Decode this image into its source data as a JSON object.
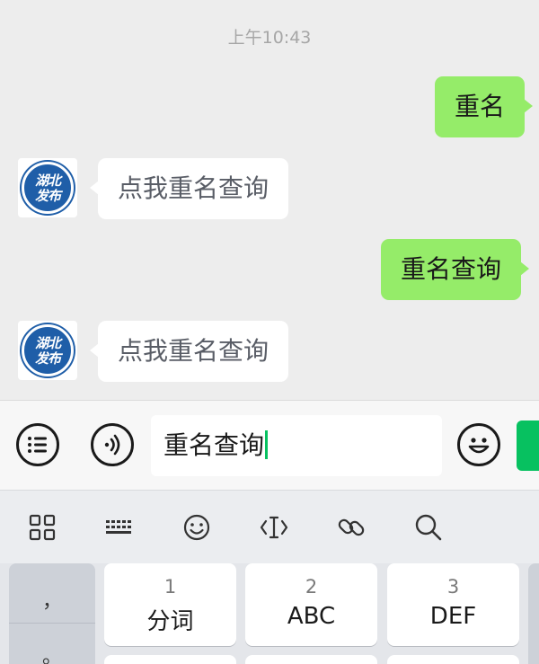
{
  "chat": {
    "timestamp": "上午10:43",
    "messages": [
      {
        "side": "out",
        "text": "重名"
      },
      {
        "side": "in",
        "text": "点我重名查询"
      },
      {
        "side": "out",
        "text": "重名查询"
      },
      {
        "side": "in",
        "text": "点我重名查询"
      }
    ]
  },
  "bot": {
    "avatar_text_line1": "湖北",
    "avatar_text_line2": "发布",
    "avatar_color": "#1f5ea8"
  },
  "input_bar": {
    "value": "重名查询",
    "left_icons": [
      "list-icon",
      "voice-icon"
    ],
    "right_icons": [
      "emoji-icon"
    ],
    "send_color": "#07c160"
  },
  "keyboard": {
    "toolbar_icons": [
      "grid-icon",
      "keyboard-icon",
      "smile-icon",
      "cursor-icon",
      "link-icon",
      "search-icon"
    ],
    "side_keys": [
      "，",
      "。"
    ],
    "keys": [
      {
        "num": "1",
        "label": "分词"
      },
      {
        "num": "2",
        "label": "ABC"
      },
      {
        "num": "3",
        "label": "DEF"
      }
    ]
  },
  "colors": {
    "outgoing_bubble": "#95ec69",
    "incoming_bubble": "#ffffff",
    "chat_background": "#ededed"
  }
}
